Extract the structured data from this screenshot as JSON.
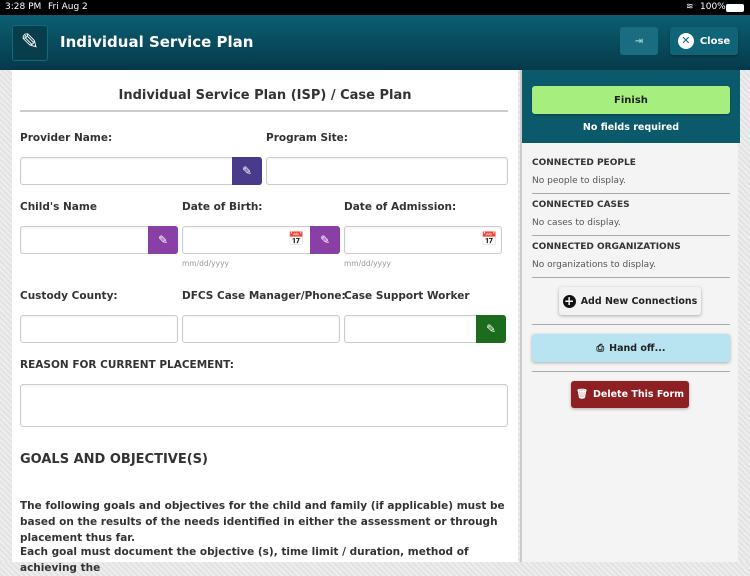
{
  "status_bar": {
    "time": "3:28 PM",
    "date": "Fri Aug 2",
    "battery": "100%"
  },
  "header": {
    "title": "Individual Service Plan",
    "close_label": "Close"
  },
  "form": {
    "title": "Individual Service Plan (ISP) / Case Plan",
    "provider_name": "Provider Name:",
    "program_site": "Program Site:",
    "childs_name": "Child's Name",
    "date_of_birth": "Date of Birth:",
    "date_of_admission": "Date of Admission:",
    "date_hint": "mm/dd/yyyy",
    "custody_county": "Custody County:",
    "dfcs_manager": "DFCS Case Manager/Phone:",
    "case_support_worker": "Case Support Worker",
    "reason_label": "REASON FOR CURRENT PLACEMENT:",
    "goals_heading": "GOALS AND OBJECTIVE(S)",
    "para1": "The following goals and objectives for the child and family (if applicable) must be based on the results of the needs identified in either the assessment or through placement thus far.",
    "para2": "Each goal must document the objective (s), time limit / duration, method of achieving the"
  },
  "sidebar": {
    "finish_label": "Finish",
    "no_fields": "No fields required",
    "people_heading": "CONNECTED PEOPLE",
    "people_empty": "No people to display.",
    "cases_heading": "CONNECTED CASES",
    "cases_empty": "No cases to display.",
    "orgs_heading": "CONNECTED ORGANIZATIONS",
    "orgs_empty": "No organizations to display.",
    "add_connections": "Add New Connections",
    "hand_off": "Hand off...",
    "delete_form": "Delete This Form"
  },
  "colors": {
    "header": "#0b5f72",
    "sig_dark": "#4a3a8c",
    "sig_purple": "#8a3fa6",
    "sig_green": "#1d6b1d",
    "finish": "#a6ef7f",
    "handoff": "#b8e4f2",
    "delete": "#8e1f22"
  }
}
